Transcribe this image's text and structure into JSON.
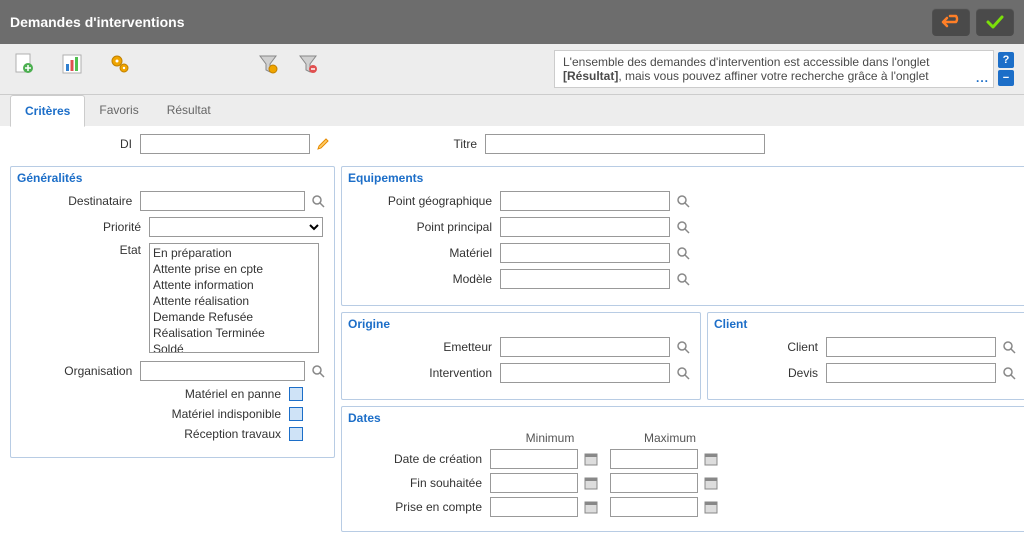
{
  "titlebar": {
    "title": "Demandes d'interventions"
  },
  "help": {
    "line": "L'ensemble des demandes d'intervention est accessible dans l'onglet ",
    "bold": "[Résultat]",
    "line2": ", mais vous pouvez affiner votre recherche grâce à l'onglet",
    "dots": "..."
  },
  "tabs": {
    "criteres": "Critères",
    "favoris": "Favoris",
    "resultat": "Résultat"
  },
  "top": {
    "di_label": "DI",
    "titre_label": "Titre"
  },
  "generalites": {
    "title": "Généralités",
    "destinataire": "Destinataire",
    "priorite": "Priorité",
    "etat": "Etat",
    "etat_options": {
      "o1": "En préparation",
      "o2": "Attente prise en cpte",
      "o3": "Attente information",
      "o4": "Attente réalisation",
      "o5": "Demande Refusée",
      "o6": "Réalisation Terminée",
      "o7": "Soldé"
    },
    "organisation": "Organisation",
    "materiel_en_panne": "Matériel en panne",
    "materiel_indisponible": "Matériel indisponible",
    "reception_travaux": "Réception travaux"
  },
  "equipements": {
    "title": "Equipements",
    "point_geographique": "Point géographique",
    "point_principal": "Point principal",
    "materiel": "Matériel",
    "modele": "Modèle"
  },
  "origine": {
    "title": "Origine",
    "emetteur": "Emetteur",
    "intervention": "Intervention"
  },
  "client": {
    "title": "Client",
    "client": "Client",
    "devis": "Devis"
  },
  "dates": {
    "title": "Dates",
    "minimum": "Minimum",
    "maximum": "Maximum",
    "date_creation": "Date de création",
    "fin_souhaitee": "Fin souhaitée",
    "prise_en_compte": "Prise en compte"
  }
}
